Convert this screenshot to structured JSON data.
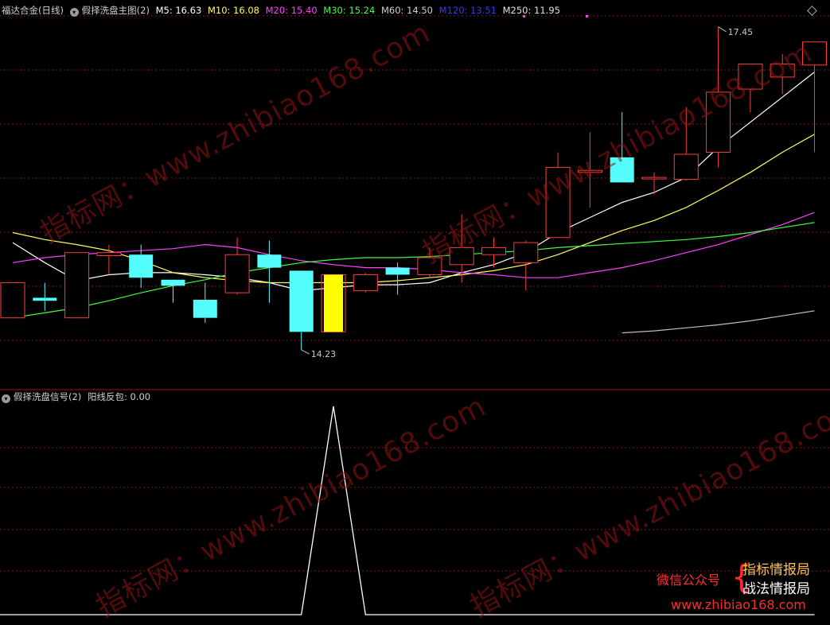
{
  "colors": {
    "background": "#000000",
    "up": "#ff3b3b",
    "down": "#54fcfc",
    "highlight": "#ffff00",
    "grid": "#7a1a1a",
    "ma5": "#ffffff",
    "ma10": "#ffff55",
    "ma20": "#ff40ff",
    "ma30": "#40ff40",
    "ma60": "#bfbfbf",
    "ma120": "#3535ff",
    "ma250": "#e0e0e0",
    "signal": "#ffffff"
  },
  "header": {
    "instrument": "福达合金",
    "period": "(日线)",
    "indicator": "假择洗盘主图(2)",
    "ma5": "M5: 16.63",
    "ma10": "M10: 16.08",
    "ma20": "M20: 15.40",
    "ma30": "M30: 15.24",
    "ma60": "M60: 14.50",
    "ma120": "M120: 13.51",
    "ma250": "M250: 11.95"
  },
  "sub_header": {
    "indicator": "假择洗盘信号(2)",
    "value_label": "阳线反包: 0.00"
  },
  "watermark": [
    "指标网：www.zhibiao168.com",
    "指标网：www.zhibiao168.com",
    "指标网：www.zhibiao168.com",
    "指标网：www.zhibiao168.com"
  ],
  "promo": {
    "left": "微信公众号",
    "right_top": "指标情报局",
    "right_bottom": "战法情报局",
    "url": "www.zhibiao168.com"
  },
  "chart_data": [
    {
      "type": "candlestick",
      "title": "假择洗盘主图(2)",
      "ylim": [
        13.85,
        17.75
      ],
      "max_label": "17.45",
      "min_label": "14.23",
      "candles": [
        {
          "o": 14.55,
          "h": 14.9,
          "l": 14.55,
          "c": 14.9
        },
        {
          "o": 14.75,
          "h": 14.9,
          "l": 14.62,
          "c": 14.72
        },
        {
          "o": 14.55,
          "h": 15.2,
          "l": 14.55,
          "c": 15.2
        },
        {
          "o": 15.17,
          "h": 15.28,
          "l": 14.98,
          "c": 15.2
        },
        {
          "o": 15.18,
          "h": 15.28,
          "l": 14.85,
          "c": 14.95
        },
        {
          "o": 14.93,
          "h": 14.93,
          "l": 14.7,
          "c": 14.87
        },
        {
          "o": 14.73,
          "h": 14.9,
          "l": 14.5,
          "c": 14.55
        },
        {
          "o": 14.8,
          "h": 15.35,
          "l": 14.78,
          "c": 15.18
        },
        {
          "o": 15.18,
          "h": 15.32,
          "l": 14.7,
          "c": 15.05
        },
        {
          "o": 15.02,
          "h": 15.02,
          "l": 14.23,
          "c": 14.41
        },
        {
          "o": 14.41,
          "h": 14.98,
          "l": 14.41,
          "c": 14.98,
          "highlight": true
        },
        {
          "o": 14.82,
          "h": 15.0,
          "l": 14.8,
          "c": 14.98
        },
        {
          "o": 15.05,
          "h": 15.1,
          "l": 14.78,
          "c": 14.98
        },
        {
          "o": 14.98,
          "h": 15.25,
          "l": 14.95,
          "c": 15.15
        },
        {
          "o": 15.08,
          "h": 15.58,
          "l": 14.9,
          "c": 15.25
        },
        {
          "o": 15.18,
          "h": 15.35,
          "l": 15.05,
          "c": 15.25
        },
        {
          "o": 15.1,
          "h": 15.32,
          "l": 14.82,
          "c": 15.3
        },
        {
          "o": 15.35,
          "h": 16.2,
          "l": 15.35,
          "c": 16.05
        },
        {
          "o": 16.0,
          "h": 16.4,
          "l": 15.65,
          "c": 16.02
        },
        {
          "o": 16.15,
          "h": 16.6,
          "l": 15.93,
          "c": 15.9
        },
        {
          "o": 15.95,
          "h": 16.0,
          "l": 15.78,
          "c": 15.95
        },
        {
          "o": 15.93,
          "h": 16.65,
          "l": 15.92,
          "c": 16.18
        },
        {
          "o": 16.2,
          "h": 17.45,
          "l": 16.05,
          "c": 16.8
        },
        {
          "o": 16.83,
          "h": 17.08,
          "l": 16.6,
          "c": 17.08
        },
        {
          "o": 16.95,
          "h": 17.18,
          "l": 16.78,
          "c": 17.08
        },
        {
          "o": 17.07,
          "h": 17.3,
          "l": 16.2,
          "c": 17.3
        }
      ],
      "series": [
        {
          "name": "M5",
          "color": "#ffffff",
          "values": [
            15.3,
            15.1,
            14.92,
            14.98,
            15.0,
            15.0,
            14.98,
            14.95,
            14.9,
            14.82,
            14.85,
            14.88,
            14.88,
            14.9,
            15.0,
            15.08,
            15.2,
            15.4,
            15.55,
            15.7,
            15.8,
            15.95,
            16.25,
            16.5,
            16.75,
            17.0
          ]
        },
        {
          "name": "M10",
          "color": "#ffff55",
          "values": [
            15.4,
            15.33,
            15.28,
            15.22,
            15.12,
            15.0,
            14.95,
            14.92,
            14.9,
            14.9,
            14.9,
            14.9,
            14.92,
            14.95,
            14.98,
            15.02,
            15.08,
            15.18,
            15.3,
            15.42,
            15.52,
            15.65,
            15.82,
            16.0,
            16.2,
            16.38
          ]
        },
        {
          "name": "M20",
          "color": "#ff40ff",
          "values": [
            15.1,
            15.15,
            15.18,
            15.2,
            15.22,
            15.24,
            15.28,
            15.25,
            15.18,
            15.12,
            15.08,
            15.05,
            15.05,
            15.03,
            15.0,
            14.98,
            14.95,
            14.95,
            15.0,
            15.05,
            15.12,
            15.2,
            15.28,
            15.38,
            15.48,
            15.6
          ]
        },
        {
          "name": "M30",
          "color": "#40ff40",
          "values": [
            14.55,
            14.6,
            14.65,
            14.72,
            14.8,
            14.87,
            14.93,
            15.0,
            15.05,
            15.1,
            15.13,
            15.15,
            15.15,
            15.16,
            15.18,
            15.2,
            15.22,
            15.25,
            15.27,
            15.29,
            15.31,
            15.33,
            15.36,
            15.4,
            15.45,
            15.5
          ]
        },
        {
          "name": "M60",
          "color": "#bfbfbf",
          "values": [
            null,
            null,
            null,
            null,
            null,
            null,
            null,
            null,
            null,
            null,
            null,
            null,
            null,
            null,
            null,
            null,
            null,
            null,
            null,
            14.4,
            14.42,
            14.45,
            14.48,
            14.52,
            14.57,
            14.62
          ]
        }
      ]
    },
    {
      "type": "line",
      "title": "假择洗盘信号(2)",
      "series": [
        {
          "name": "阳线反包",
          "color": "#ffffff",
          "values": [
            0,
            0,
            0,
            0,
            0,
            0,
            0,
            0,
            0,
            0,
            1,
            0,
            0,
            0,
            0,
            0,
            0,
            0,
            0,
            0,
            0,
            0,
            0,
            0,
            0,
            0
          ]
        }
      ],
      "ylim": [
        0,
        1
      ]
    }
  ]
}
